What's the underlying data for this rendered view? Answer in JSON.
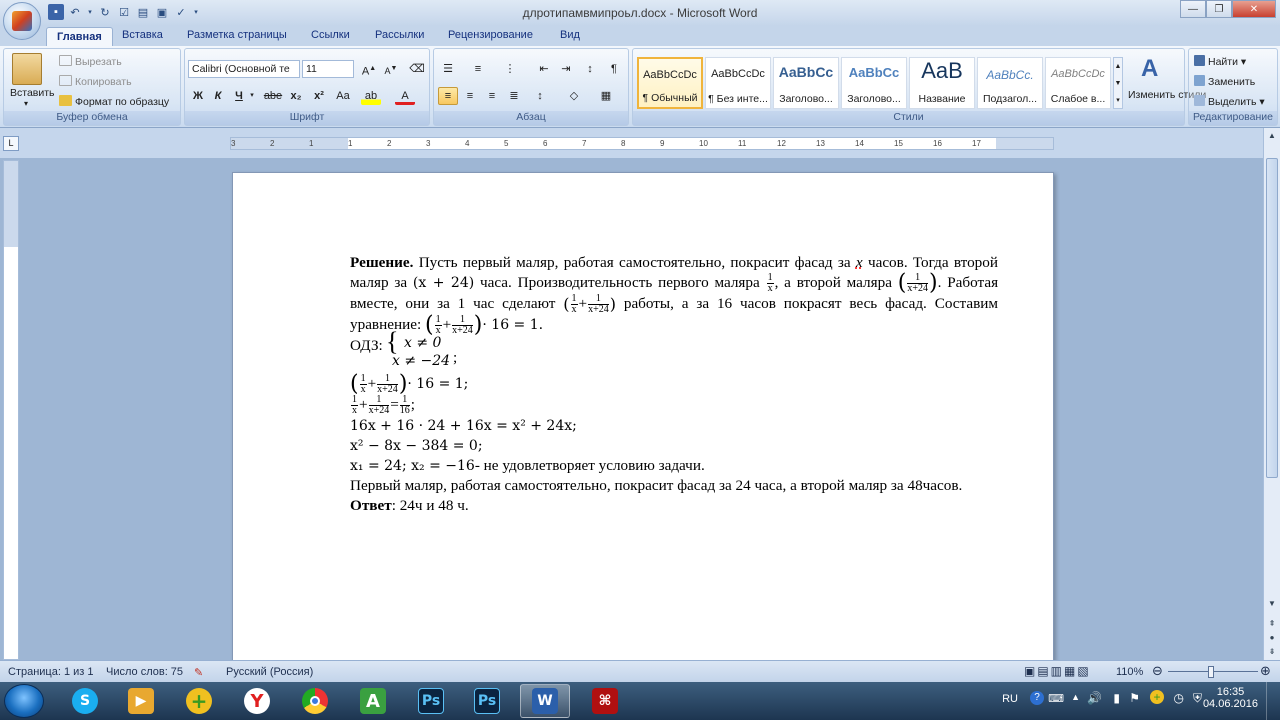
{
  "window": {
    "title": "длротипамвмипроьл.docx - Microsoft Word"
  },
  "tabs": [
    "Главная",
    "Вставка",
    "Разметка страницы",
    "Ссылки",
    "Рассылки",
    "Рецензирование",
    "Вид"
  ],
  "clipboard": {
    "paste": "Вставить",
    "cut": "Вырезать",
    "copy": "Копировать",
    "format_painter": "Формат по образцу",
    "label": "Буфер обмена"
  },
  "font": {
    "name": "Calibri (Основной те",
    "size": "11",
    "label": "Шрифт",
    "bold": "Ж",
    "italic": "К",
    "underline": "Ч",
    "strike": "abe",
    "sub": "x₂",
    "sup": "x²",
    "case": "Aa"
  },
  "paragraph": {
    "label": "Абзац"
  },
  "styles": {
    "label": "Стили",
    "items": [
      {
        "preview": "AaBbCcDc",
        "name": "¶ Обычный"
      },
      {
        "preview": "AaBbCcDc",
        "name": "¶ Без инте..."
      },
      {
        "preview": "AaBbCc",
        "name": "Заголово..."
      },
      {
        "preview": "AaBbCc",
        "name": "Заголово..."
      },
      {
        "preview": "AaB",
        "name": "Название"
      },
      {
        "preview": "AaBbCc.",
        "name": "Подзагол..."
      },
      {
        "preview": "AaBbCcDc",
        "name": "Слабое в..."
      }
    ],
    "change": "Изменить стили"
  },
  "editing": {
    "label": "Редактирование",
    "find": "Найти",
    "replace": "Заменить",
    "select": "Выделить"
  },
  "ruler": {
    "labels": [
      "3",
      "2",
      "1",
      "1",
      "2",
      "3",
      "4",
      "5",
      "6",
      "7",
      "8",
      "9",
      "10",
      "11",
      "12",
      "13",
      "14",
      "15",
      "16",
      "17"
    ]
  },
  "document": {
    "p1_bold": "Решение.",
    "p1a": "Пусть первый маляр, работая самостоятельно, покрасит фасад за",
    "p1x": "x",
    "p1b": "часов. Тогда второй маляр за",
    "p1c": "(x + 24)",
    "p1d": "часа. Производительность первого маляра",
    "p1e": ", а второй маляра",
    "p1f": ". Работая вместе, они за 1 час сделают",
    "p1g": "работы, а за 16 часов покрасят весь фасад. Составим уравнение:",
    "p1h": "· 16 = 1.",
    "odz_label": "ОДЗ:",
    "odz1": "x ≠ 0",
    "odz2": "x ≠ −24",
    "eq1": "· 16 = 1;",
    "eq3": "16x + 16 · 24 + 16x = x² + 24x;",
    "eq4": "x² − 8x − 384 = 0;",
    "eq5": "x₁ = 24; x₂ = −16",
    "eq5b": "- не удовлетворяет условию задачи.",
    "p_final": "Первый маляр, работая самостоятельно, покрасит фасад за 24 часа, а второй маляр за 48часов.",
    "answer_bold": "Ответ",
    "answer": ": 24ч и 48 ч.",
    "f_1": "1",
    "f_x": "x",
    "f_x24": "x+24",
    "f_16": "16"
  },
  "status": {
    "page": "Страница: 1 из 1",
    "words": "Число слов: 75",
    "lang": "Русский (Россия)",
    "zoom": "110%"
  },
  "taskbar": {
    "lang": "RU",
    "time": "16:35",
    "date": "04.06.2016"
  }
}
